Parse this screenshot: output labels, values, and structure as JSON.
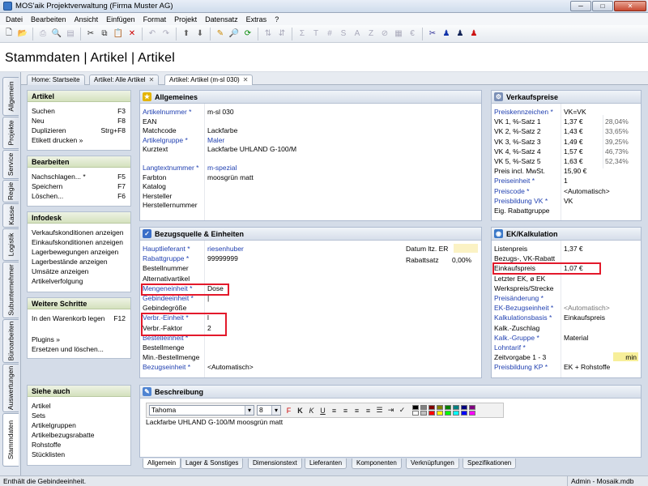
{
  "window": {
    "title": "MOS'aik Projektverwaltung (Firma Muster AG)",
    "minimize": "─",
    "maximize": "□",
    "close": "✕"
  },
  "menu": [
    "Datei",
    "Bearbeiten",
    "Ansicht",
    "Einfügen",
    "Format",
    "Projekt",
    "Datensatz",
    "Extras",
    "?"
  ],
  "toolbar_icons": [
    {
      "icon": "new-icon",
      "glyph": "🗋"
    },
    {
      "icon": "open-icon",
      "glyph": "📂"
    },
    {
      "sep": true
    },
    {
      "icon": "print-icon",
      "glyph": "⎙",
      "dim": true
    },
    {
      "icon": "preview-icon",
      "glyph": "🔍",
      "dim": true
    },
    {
      "icon": "page-icon",
      "glyph": "▤",
      "dim": true
    },
    {
      "sep": true
    },
    {
      "icon": "cut-icon",
      "glyph": "✂"
    },
    {
      "icon": "copy-icon",
      "glyph": "⧉"
    },
    {
      "icon": "paste-icon",
      "glyph": "📋"
    },
    {
      "icon": "delete-icon",
      "glyph": "✕",
      "color": "#c00"
    },
    {
      "sep": true
    },
    {
      "icon": "undo-icon",
      "glyph": "↶",
      "dim": true
    },
    {
      "icon": "redo-icon",
      "glyph": "↷",
      "dim": true
    },
    {
      "sep": true
    },
    {
      "icon": "up-icon",
      "glyph": "⬆",
      "color": "#666"
    },
    {
      "icon": "down-icon",
      "glyph": "⬇",
      "color": "#666"
    },
    {
      "sep": true
    },
    {
      "icon": "pencil-icon",
      "glyph": "✎",
      "color": "#c80"
    },
    {
      "icon": "find-icon",
      "glyph": "🔎"
    },
    {
      "icon": "refresh-icon",
      "glyph": "⟳",
      "color": "#080"
    },
    {
      "sep": true
    },
    {
      "icon": "sort-asc-icon",
      "glyph": "⇅",
      "dim": true
    },
    {
      "icon": "sort-desc-icon",
      "glyph": "⇵",
      "dim": true
    },
    {
      "sep": true
    },
    {
      "icon": "sum-icon",
      "glyph": "Σ",
      "dim": true
    },
    {
      "icon": "text-t-icon",
      "glyph": "T",
      "dim": true
    },
    {
      "icon": "hash-icon",
      "glyph": "#",
      "dim": true
    },
    {
      "icon": "s-icon",
      "glyph": "S",
      "dim": true
    },
    {
      "icon": "a-icon",
      "glyph": "A",
      "dim": true
    },
    {
      "icon": "z-icon",
      "glyph": "Z",
      "dim": true
    },
    {
      "icon": "filter-icon",
      "glyph": "⊘",
      "dim": true
    },
    {
      "icon": "date-icon",
      "glyph": "▦",
      "dim": true
    },
    {
      "icon": "euro-icon",
      "glyph": "€",
      "dim": true
    },
    {
      "sep": true
    },
    {
      "icon": "tools-icon",
      "glyph": "✂",
      "color": "#339"
    },
    {
      "icon": "user-blue-icon",
      "glyph": "♟",
      "color": "#13a"
    },
    {
      "icon": "user-dark-icon",
      "glyph": "♟",
      "color": "#125"
    },
    {
      "icon": "user-red-icon",
      "glyph": "♟",
      "color": "#c11"
    }
  ],
  "page_title": "Stammdaten | Artikel | Artikel",
  "vertical_tabs": [
    "Allgemein",
    "Projekte",
    "Service",
    "Regie",
    "Kasse",
    "Logistik",
    "Subunternehmer",
    "Büroarbeiten",
    "Auswertungen",
    "Stammdaten"
  ],
  "tabs": [
    {
      "label": "Home: Startseite"
    },
    {
      "label": "Artikel: Alle Artikel",
      "close": "✕"
    },
    {
      "label": "Artikel: Artikel (m-sl 030)",
      "close": "✕"
    }
  ],
  "side": {
    "artikel": {
      "title": "Artikel",
      "items": [
        {
          "label": "Suchen",
          "key": "F3"
        },
        {
          "label": "Neu",
          "key": "F8"
        },
        {
          "label": "Duplizieren",
          "key": "Strg+F8"
        },
        {
          "label": "Etikett drucken »",
          "key": ""
        }
      ]
    },
    "bearbeiten": {
      "title": "Bearbeiten",
      "items": [
        {
          "label": "Nachschlagen... *",
          "key": "F5"
        },
        {
          "label": "Speichern",
          "key": "F7"
        },
        {
          "label": "Löschen...",
          "key": "F6"
        }
      ]
    },
    "infodesk": {
      "title": "Infodesk",
      "items": [
        {
          "label": "Verkaufskonditionen anzeigen"
        },
        {
          "label": "Einkaufskonditionen anzeigen"
        },
        {
          "label": "Lagerbewegungen anzeigen"
        },
        {
          "label": "Lagerbestände anzeigen"
        },
        {
          "label": "Umsätze anzeigen"
        },
        {
          "label": "Artikelverfolgung"
        }
      ]
    },
    "weitere": {
      "title": "Weitere Schritte",
      "items": [
        {
          "label": "In den Warenkorb legen",
          "key": "F12"
        },
        {
          "gap": true
        },
        {
          "label": "Plugins »",
          "key": ""
        },
        {
          "label": "Ersetzen und löschen...",
          "key": ""
        }
      ]
    },
    "siehe": {
      "title": "Siehe auch",
      "items": [
        {
          "label": "Artikel"
        },
        {
          "label": "Sets"
        },
        {
          "label": "Artikelgruppen"
        },
        {
          "label": "Artikelbezugsrabatte"
        },
        {
          "label": "Rohstoffe"
        },
        {
          "label": "Stücklisten"
        }
      ]
    }
  },
  "allgemeines": {
    "title": "Allgemeines",
    "rows": [
      {
        "label": "Artikelnummer *",
        "value": "m-sl 030",
        "link": true
      },
      {
        "label": "EAN",
        "value": ""
      },
      {
        "label": "Matchcode",
        "value": "Lackfarbe"
      },
      {
        "label": "Artikelgruppe *",
        "value": "Maler",
        "link": true,
        "vlink": true
      },
      {
        "label": "Kurztext",
        "value": "Lackfarbe UHLAND G-100/M"
      },
      {
        "label": "",
        "value": ""
      },
      {
        "label": "Langtextnummer *",
        "value": "m-spezial",
        "link": true,
        "vlink": true
      },
      {
        "label": "Farbton",
        "value": "moosgrün matt"
      },
      {
        "label": "Katalog",
        "value": ""
      },
      {
        "label": "Hersteller",
        "value": ""
      },
      {
        "label": "Herstellernummer",
        "value": ""
      }
    ]
  },
  "verkaufspreise": {
    "title": "Verkaufspreise",
    "rows": [
      {
        "label": "Preiskennzeichen *",
        "value": "VK=VK",
        "link": true
      },
      {
        "label": "VK 1, %-Satz 1",
        "value": "1,37 €",
        "pct": "28,04%"
      },
      {
        "label": "VK 2, %-Satz 2",
        "value": "1,43 €",
        "pct": "33,65%"
      },
      {
        "label": "VK 3, %-Satz 3",
        "value": "1,49 €",
        "pct": "39,25%"
      },
      {
        "label": "VK 4, %-Satz 4",
        "value": "1,57 €",
        "pct": "46,73%"
      },
      {
        "label": "VK 5, %-Satz 5",
        "value": "1,63 €",
        "pct": "52,34%"
      },
      {
        "label": "Preis incl. MwSt.",
        "value": "15,90 €"
      },
      {
        "label": "Preiseinheit *",
        "value": "1",
        "link": true
      },
      {
        "label": "Preiscode *",
        "value": "<Automatisch>",
        "link": true
      },
      {
        "label": "Preisbildung VK *",
        "value": "VK",
        "link": true
      },
      {
        "label": "Eig. Rabattgruppe",
        "value": ""
      }
    ]
  },
  "bezugsquelle": {
    "title": "Bezugsquelle & Einheiten",
    "rows": [
      {
        "label": "Hauptlieferant *",
        "value": "riesenhuber",
        "link": true,
        "vlink": true
      },
      {
        "label": "Rabattgruppe *",
        "value": "99999999",
        "link": true
      },
      {
        "label": "Bestellnummer",
        "value": ""
      },
      {
        "label": "Alternativartikel",
        "value": ""
      },
      {
        "label": "Mengeneinheit *",
        "value": "Dose",
        "link": true
      },
      {
        "label": "Gebindeeinheit *",
        "value": "|",
        "link": true
      },
      {
        "label": "Gebindegröße",
        "value": ""
      },
      {
        "label": "Verbr.-Einheit *",
        "value": "l",
        "link": true
      },
      {
        "label": "Verbr.-Faktor",
        "value": "2"
      },
      {
        "label": "Bestelleinheit *",
        "value": "",
        "link": true
      },
      {
        "label": "Bestellmenge",
        "value": ""
      },
      {
        "label": "Min.-Bestellmenge",
        "value": ""
      },
      {
        "label": "Bezugseinheit *",
        "value": "<Automatisch>",
        "link": true
      }
    ],
    "extra": [
      {
        "label": "Datum ltz. ER",
        "value": ""
      },
      {
        "label": "Rabattsatz",
        "value": "0,00%"
      }
    ]
  },
  "ek": {
    "title": "EK/Kalkulation",
    "rows": [
      {
        "label": "Listenpreis",
        "value": "1,37 €"
      },
      {
        "label": "Bezugs-, VK-Rabatt",
        "value": ""
      },
      {
        "label": "Einkaufspreis",
        "value": "1,07 €"
      },
      {
        "label": "Letzter EK, ø EK",
        "value": ""
      },
      {
        "label": "Werkspreis/Strecke",
        "value": ""
      },
      {
        "label": "Preisänderung *",
        "value": "",
        "link": true
      },
      {
        "label": "EK-Bezugseinheit *",
        "value": "<Automatisch>",
        "link": true,
        "dim": true
      },
      {
        "label": "Kalkulationsbasis *",
        "value": "Einkaufspreis",
        "link": true
      },
      {
        "label": "Kalk.-Zuschlag",
        "value": ""
      },
      {
        "label": "Kalk.-Gruppe *",
        "value": "Material",
        "link": true
      },
      {
        "label": "Lohntarif *",
        "value": "",
        "link": true
      },
      {
        "label": "Zeitvorgabe 1 - 3",
        "value": "",
        "unit": "min"
      },
      {
        "label": "Preisbildung KP *",
        "value": "EK + Rohstoffe",
        "link": true
      }
    ]
  },
  "beschreibung": {
    "title": "Beschreibung",
    "font": "Tahoma",
    "size": "8",
    "format_buttons": [
      {
        "icon": "font-color-icon",
        "glyph": "F",
        "color": "#c00"
      },
      {
        "icon": "bold-icon",
        "glyph": "K"
      },
      {
        "icon": "italic-icon",
        "glyph": "K"
      },
      {
        "icon": "underline-icon",
        "glyph": "U"
      },
      {
        "icon": "align-left-icon",
        "glyph": "≡"
      },
      {
        "icon": "align-center-icon",
        "glyph": "≡"
      },
      {
        "icon": "align-right-icon",
        "glyph": "≡"
      },
      {
        "icon": "justify-icon",
        "glyph": "≡"
      },
      {
        "icon": "bullets-icon",
        "glyph": "☰"
      },
      {
        "icon": "indent-icon",
        "glyph": "⇥"
      },
      {
        "icon": "spellcheck-icon",
        "glyph": "✓"
      }
    ],
    "swatches": [
      "#000000",
      "#808080",
      "#800000",
      "#808000",
      "#008000",
      "#008080",
      "#000080",
      "#800080",
      "#ffffff",
      "#c0c0c0",
      "#ff0000",
      "#ffff00",
      "#00ff00",
      "#00ffff",
      "#0000ff",
      "#ff00ff"
    ],
    "text": "Lackfarbe UHLAND G-100/M moosgrün matt"
  },
  "bottom_tabs": [
    "Allgemein",
    "Lager & Sonstiges",
    "Dimensionstext",
    "Lieferanten",
    "Komponenten",
    "Verknüpfungen",
    "Spezifikationen"
  ],
  "status": {
    "left": "Enthält die Gebindeeinheit.",
    "right": "Admin - Mosaik.mdb"
  },
  "colors": {
    "link": "#1f3fb0",
    "highlight": "#e3192b",
    "panel_head": "#d6deea"
  }
}
